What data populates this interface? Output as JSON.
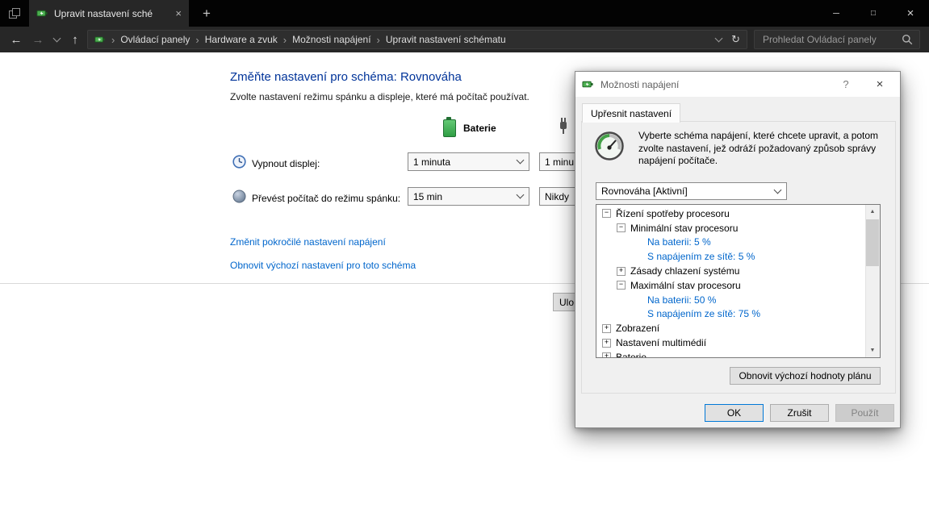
{
  "icons": {
    "back": "←",
    "forward": "→",
    "up": "↑",
    "refresh": "↻",
    "minimize": "─",
    "maximize": "□",
    "close": "×",
    "tab_close": "×",
    "new_tab": "+",
    "help": "?",
    "dialog_close": "×",
    "scroll_up": "▲",
    "scroll_down": "▼"
  },
  "titlebar": {
    "tab_title": "Upravit nastavení sché"
  },
  "breadcrumb": {
    "separator": "›",
    "items": [
      "Ovládací panely",
      "Hardware a zvuk",
      "Možnosti napájení",
      "Upravit nastavení schématu"
    ]
  },
  "search": {
    "placeholder": "Prohledat Ovládací panely"
  },
  "main": {
    "title": "Změňte nastavení pro schéma: Rovnováha",
    "subtitle": "Zvolte nastavení režimu spánku a displeje, které má počítač používat.",
    "battery_header": "Baterie",
    "rows": [
      {
        "label": "Vypnout displej:",
        "battery_value": "1 minuta",
        "ac_value": "1 minu"
      },
      {
        "label": "Převést počítač do režimu spánku:",
        "battery_value": "15 min",
        "ac_value": "Nikdy"
      }
    ],
    "links": [
      "Změnit pokročilé nastavení napájení",
      "Obnovit výchozí nastavení pro toto schéma"
    ],
    "save_button": "Ulo"
  },
  "dialog": {
    "title": "Možnosti napájení",
    "tab": "Upřesnit nastavení",
    "description": "Vyberte schéma napájení, které chcete upravit, a potom zvolte nastavení, jež odráží požadovaný způsob správy napájení počítače.",
    "plan": "Rovnováha [Aktivní]",
    "tree": [
      {
        "label": "Řízení spotřeby procesoru",
        "glyph": "−"
      },
      {
        "label": "Minimální stav procesoru",
        "glyph": "−"
      },
      {
        "label": "Na baterii: 5 %",
        "glyph": ""
      },
      {
        "label": "S napájením ze sítě: 5 %",
        "glyph": ""
      },
      {
        "label": "Zásady chlazení systému",
        "glyph": "+"
      },
      {
        "label": "Maximální stav procesoru",
        "glyph": "−"
      },
      {
        "label": "Na baterii: 50 %",
        "glyph": ""
      },
      {
        "label": "S napájením ze sítě: 75 %",
        "glyph": ""
      },
      {
        "label": "Zobrazení",
        "glyph": "+"
      },
      {
        "label": "Nastavení multimédií",
        "glyph": "+"
      },
      {
        "label": "Baterie",
        "glyph": "+"
      }
    ],
    "restore_button": "Obnovit výchozí hodnoty plánu",
    "ok": "OK",
    "cancel": "Zrušit",
    "apply": "Použít"
  },
  "colors": {
    "header_blue": "#003399",
    "link_blue": "#0066cc",
    "titlebar_bg": "#030303",
    "dialog_bg": "#f0f0f0",
    "battery_green": "#2f9e44"
  }
}
